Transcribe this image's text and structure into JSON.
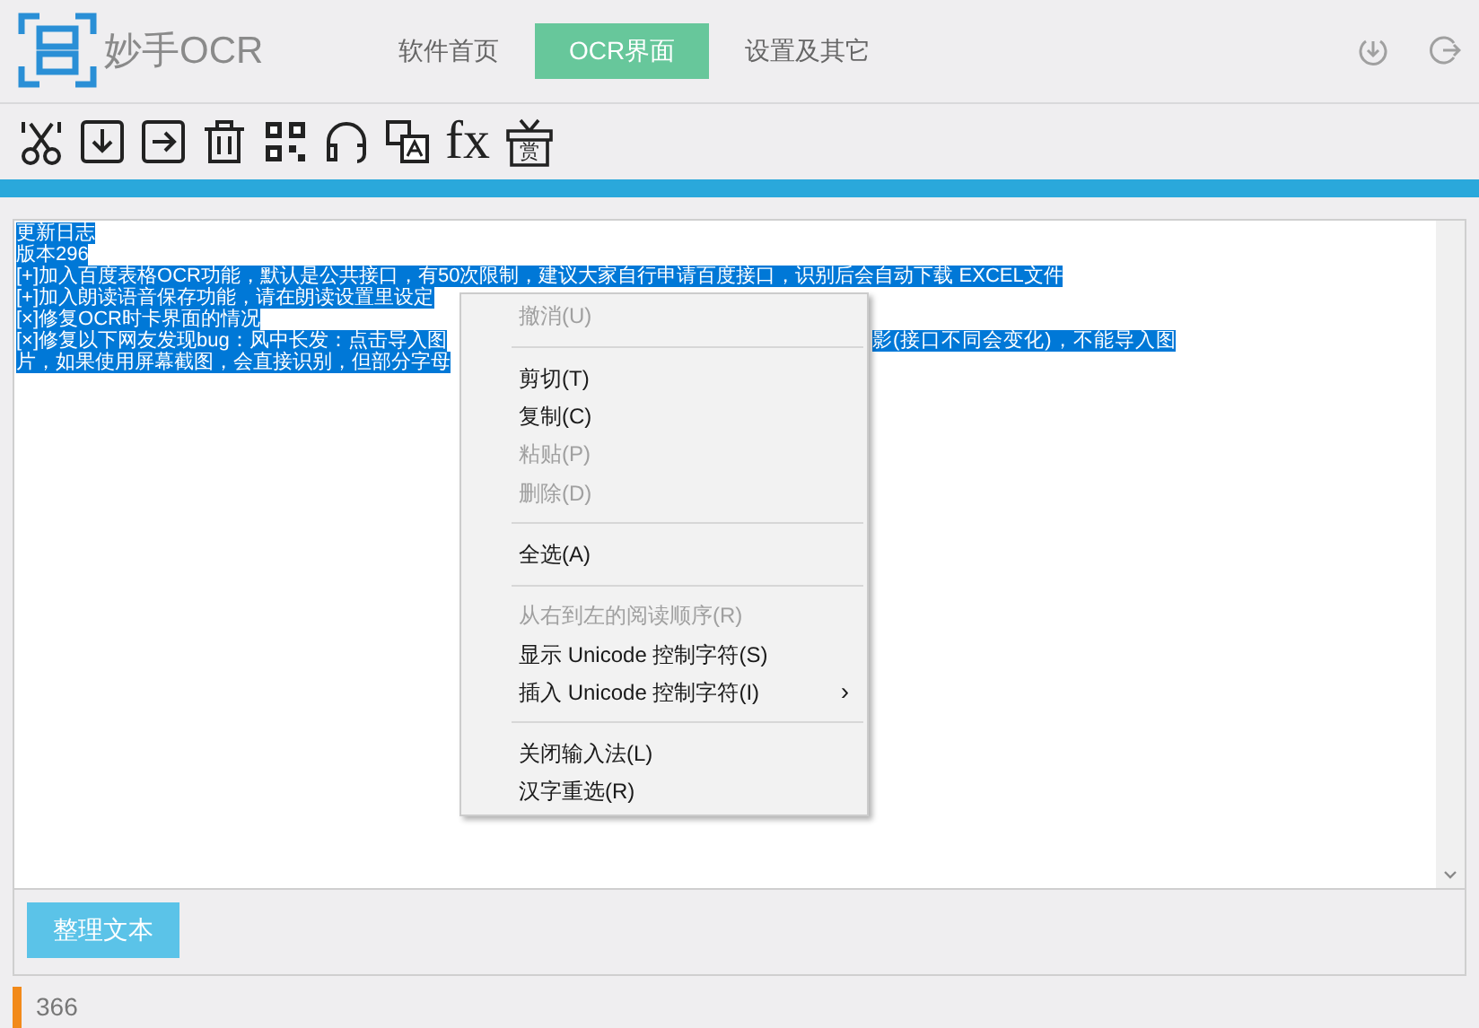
{
  "app": {
    "logo_text": "妙手OCR"
  },
  "nav_tabs": [
    {
      "label": "软件首页",
      "selected": false
    },
    {
      "label": "OCR界面",
      "selected": true
    },
    {
      "label": "设置及其它",
      "selected": false
    }
  ],
  "toolbar": {
    "formula_label": "fx",
    "reward_label": "赏"
  },
  "editor": {
    "lines": [
      {
        "text": "更新日志"
      },
      {
        "text": "版本296"
      },
      {
        "text": "[+]加入百度表格OCR功能，默认是公共接口，有50次限制，建议大家自行申请百度接口，识别后会自动下载 EXCEL文件"
      },
      {
        "text": "[+]加入朗读语音保存功能，请在朗读设置里设定"
      },
      {
        "text": "[×]修复OCR时卡界面的情况"
      },
      {
        "text": "[×]修复以下网友发现bug：风中长发：点击导入图",
        "after_menu": "影(接口不同会变化)，不能导入图"
      },
      {
        "text": "片，如果使用屏幕截图，会直接识别，但部分字母"
      }
    ]
  },
  "context_menu": [
    {
      "kind": "item",
      "label": "撤消(U)",
      "disabled": true
    },
    {
      "kind": "separator"
    },
    {
      "kind": "item",
      "label": "剪切(T)",
      "disabled": false
    },
    {
      "kind": "item",
      "label": "复制(C)",
      "disabled": false
    },
    {
      "kind": "item",
      "label": "粘贴(P)",
      "disabled": true
    },
    {
      "kind": "item",
      "label": "删除(D)",
      "disabled": true
    },
    {
      "kind": "separator"
    },
    {
      "kind": "item",
      "label": "全选(A)",
      "disabled": false
    },
    {
      "kind": "separator"
    },
    {
      "kind": "item",
      "label": "从右到左的阅读顺序(R)",
      "disabled": true
    },
    {
      "kind": "item",
      "label": "显示 Unicode 控制字符(S)",
      "disabled": false
    },
    {
      "kind": "item",
      "label": "插入 Unicode 控制字符(I)",
      "disabled": false,
      "arrow": "›"
    },
    {
      "kind": "separator"
    },
    {
      "kind": "item",
      "label": "关闭输入法(L)",
      "disabled": false
    },
    {
      "kind": "item",
      "label": "汉字重选(R)",
      "disabled": false
    }
  ],
  "tidy_button": "整理文本",
  "status_bar": {
    "count": "366"
  }
}
